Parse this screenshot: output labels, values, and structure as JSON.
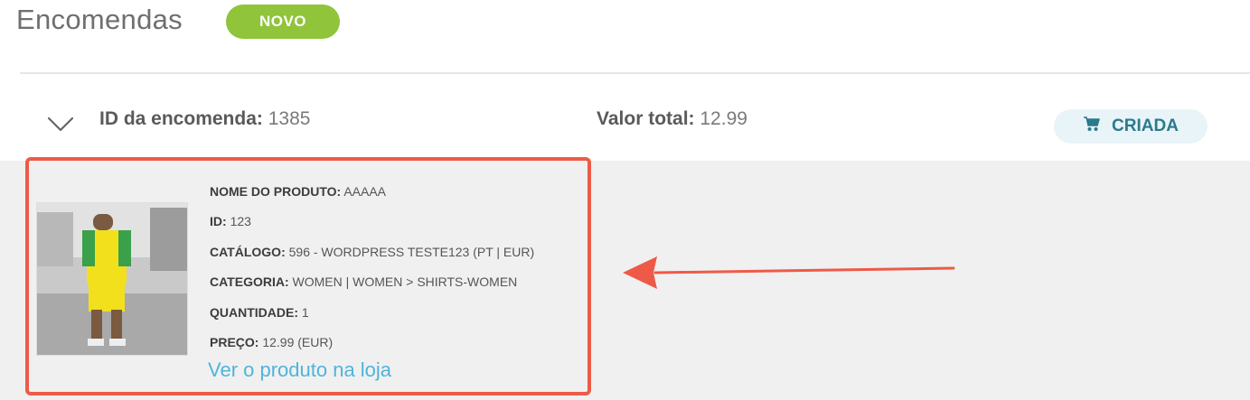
{
  "header": {
    "title": "Encomendas",
    "new_badge": "NOVO"
  },
  "order": {
    "id_label": "ID da encomenda:",
    "id_value": "1385",
    "total_label": "Valor total:",
    "total_value": "12.99",
    "status": "CRIADA",
    "status_icon": "cart-icon"
  },
  "product": {
    "image_alt": "product-photo",
    "details": [
      {
        "label": "NOME DO PRODUTO:",
        "value": "AAAAA"
      },
      {
        "label": "ID:",
        "value": "123"
      },
      {
        "label": "CATÁLOGO:",
        "value": "596 - WORDPRESS TESTE123 (PT | EUR)"
      },
      {
        "label": "CATEGORIA:",
        "value": "WOMEN | WOMEN > SHIRTS-WOMEN"
      },
      {
        "label": "QUANTIDADE:",
        "value": "1"
      },
      {
        "label": "PREÇO:",
        "value": "12.99 (EUR)"
      }
    ],
    "store_link": "Ver o produto na loja"
  },
  "colors": {
    "accent_green": "#8fc43b",
    "highlight_red": "#ee5a48",
    "link_blue": "#4fb4da",
    "status_teal": "#2a7a8c"
  }
}
